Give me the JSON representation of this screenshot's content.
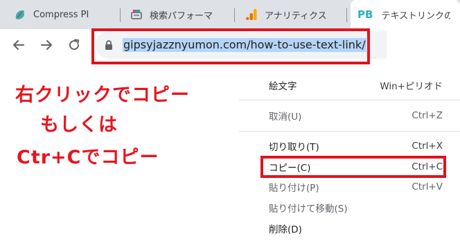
{
  "tabs": [
    {
      "title": "Compress PI",
      "icon": "compress-bird-icon",
      "active": false
    },
    {
      "title": "検索パフォーマ",
      "icon": "search-console-icon",
      "active": false
    },
    {
      "title": "アナリティクス",
      "icon": "analytics-icon",
      "active": false
    },
    {
      "title": "テキストリンクの",
      "icon": "pb-logo-icon",
      "icon_text": "PB",
      "active": true
    }
  ],
  "address_bar": {
    "url": "gipsyjazznyumon.com/how-to-use-text-link/"
  },
  "annotations": {
    "line1": "右クリックでコピー",
    "line2": "もしくは",
    "line3": "Ctr+Cでコピー"
  },
  "context_menu": {
    "items": [
      {
        "label": "絵文字",
        "shortcut": "Win+ピリオド",
        "enabled": true
      },
      {
        "label": "取消(U)",
        "shortcut": "Ctrl+Z",
        "enabled": false
      },
      {
        "label": "切り取り(T)",
        "shortcut": "Ctrl+X",
        "enabled": true
      },
      {
        "label": "コピー(C)",
        "shortcut": "Ctrl+C",
        "enabled": true
      },
      {
        "label": "貼り付け(P)",
        "shortcut": "Ctrl+V",
        "enabled": false
      },
      {
        "label": "貼り付けて移動(S)",
        "shortcut": "",
        "enabled": false
      },
      {
        "label": "削除(D)",
        "shortcut": "",
        "enabled": true
      }
    ]
  },
  "colors": {
    "annotation_red": "#e8141f",
    "tabstrip_bg": "#dee1e6",
    "url_selection": "#b5d4f7",
    "pb_logo": "#2bb3c0"
  }
}
